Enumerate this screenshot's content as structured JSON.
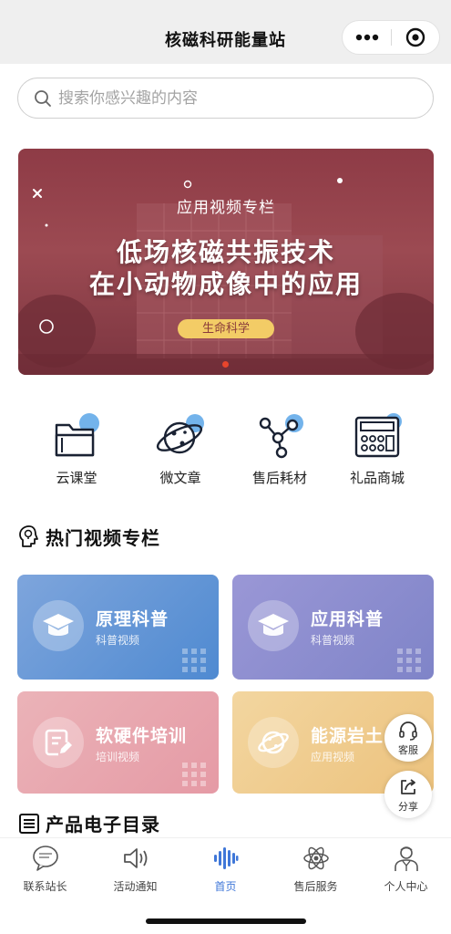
{
  "app": {
    "title": "核磁科研能量站"
  },
  "search": {
    "placeholder": "搜索你感兴趣的内容"
  },
  "banner": {
    "subtitle": "应用视频专栏",
    "headline_line1": "低场核磁共振技术",
    "headline_line2": "在小动物成像中的应用",
    "tag": "生命科学"
  },
  "quick_menu": [
    {
      "label": "云课堂",
      "icon": "folder-icon"
    },
    {
      "label": "微文章",
      "icon": "planet-icon"
    },
    {
      "label": "售后耗材",
      "icon": "molecule-icon"
    },
    {
      "label": "礼品商城",
      "icon": "register-icon"
    }
  ],
  "section_hot": {
    "title": "热门视频专栏",
    "icon": "bulb-head-icon"
  },
  "cards": [
    {
      "title": "原理科普",
      "subtitle": "科普视频",
      "icon": "graduation-cap-icon",
      "color": "#5b91d5"
    },
    {
      "title": "应用科普",
      "subtitle": "科普视频",
      "icon": "graduation-cap-icon",
      "color": "#8b8ccf"
    },
    {
      "title": "软硬件培训",
      "subtitle": "培训视频",
      "icon": "document-edit-icon",
      "color": "#e8a3ad"
    },
    {
      "title": "能源岩土",
      "subtitle": "应用视频",
      "icon": "planet-icon",
      "color": "#efc985"
    }
  ],
  "floating": {
    "service": "客服",
    "share": "分享"
  },
  "section_catalog": {
    "title": "产品电子目录",
    "icon": "catalog-icon"
  },
  "tabbar": [
    {
      "label": "联系站长",
      "icon": "chat-bubble-icon",
      "active": false
    },
    {
      "label": "活动通知",
      "icon": "speaker-icon",
      "active": false
    },
    {
      "label": "首页",
      "icon": "wave-icon",
      "active": true
    },
    {
      "label": "售后服务",
      "icon": "atom-icon",
      "active": false
    },
    {
      "label": "个人中心",
      "icon": "doctor-icon",
      "active": false
    }
  ],
  "colors": {
    "accent": "#3f77d8",
    "banner": "#8e3b46",
    "tag": "#f3cc66"
  }
}
